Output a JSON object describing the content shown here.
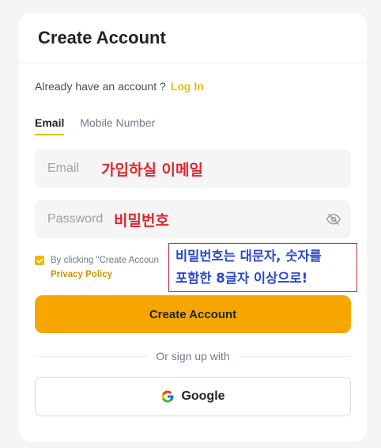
{
  "header": {
    "title": "Create Account"
  },
  "login": {
    "prompt": "Already have an account ?",
    "link": "Log In"
  },
  "tabs": [
    {
      "label": "Email",
      "active": true
    },
    {
      "label": "Mobile Number",
      "active": false
    }
  ],
  "email": {
    "placeholder": "Email",
    "overlay": "가입하실 이메일"
  },
  "password": {
    "placeholder": "Password",
    "overlay": "비밀번호",
    "icon": "eye-off-icon"
  },
  "terms": {
    "checked": true,
    "text": "By clicking \"Create Accoun",
    "privacy": "Privacy Policy"
  },
  "note": {
    "line1": "비밀번호는 대문자, 숫자를",
    "line2": "포함한 8글자 이상으로!"
  },
  "create_button": "Create Account",
  "divider": "Or sign up with",
  "google_button": {
    "label": "Google",
    "icon": "google-logo-icon"
  },
  "colors": {
    "accent": "#f0b90b",
    "button": "#f7a600",
    "overlay_red": "#e0262d",
    "note_blue": "#2b49cc"
  }
}
